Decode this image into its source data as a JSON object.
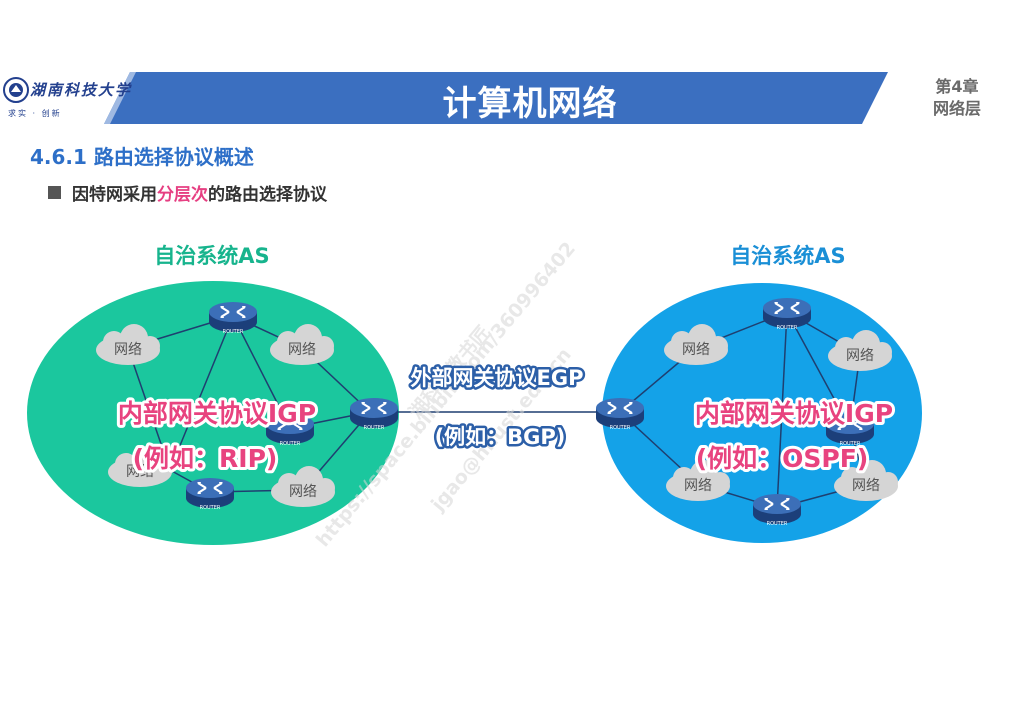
{
  "header": {
    "course_title": "计算机网络",
    "chapter_line1": "第4章",
    "chapter_line2": "网络层",
    "logo_name": "湖南科技大学",
    "logo_motto": "求实 · 创新"
  },
  "section": {
    "title": "4.6.1 路由选择协议概述",
    "bullet_before": "因特网采用",
    "bullet_highlight": "分层次",
    "bullet_after": "的路由选择协议"
  },
  "colors": {
    "header_blue": "#3b6fc0",
    "as_left": "#1bc79e",
    "as_right": "#14a2e8",
    "highlight_pink": "#e63f82",
    "label_fill": "#e8437f",
    "label_outline": "#ffffff"
  },
  "diagram": {
    "left_as": {
      "title": "自治系统AS",
      "igp_line1": "内部网关协议IGP",
      "igp_line2": "(例如：RIP)",
      "cloud_label": "网络",
      "router_label": "ROUTER"
    },
    "right_as": {
      "title": "自治系统AS",
      "igp_line1": "内部网关协议IGP",
      "igp_line2": "(例如：OSPF)",
      "cloud_label": "网络",
      "router_label": "ROUTER"
    },
    "egp_line1": "外部网关协议EGP",
    "egp_line2": "(例如：BGP)"
  },
  "watermark": {
    "line1": "https://space.bilibili.com/360996402",
    "line2": "湖科大教书匠",
    "line3": "jgao@hnust.edu.cn"
  }
}
